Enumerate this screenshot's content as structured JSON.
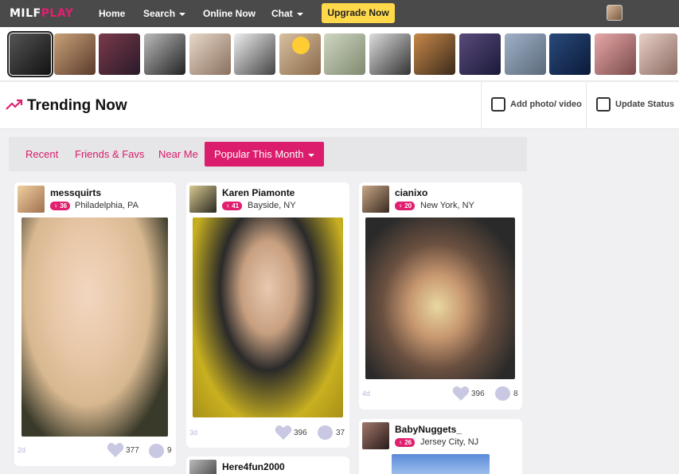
{
  "brand": {
    "logo_part1": "MILF",
    "logo_part2": "PLAY"
  },
  "nav": {
    "home": "Home",
    "search": "Search",
    "online_now": "Online Now",
    "chat": "Chat",
    "upgrade": "Upgrade Now"
  },
  "trending": {
    "title": "Trending Now",
    "add_photo": "Add photo/ video",
    "update_status": "Update Status"
  },
  "tabs": {
    "recent": "Recent",
    "friends": "Friends & Favs",
    "near": "Near Me",
    "popular": "Popular This Month"
  },
  "cards": [
    {
      "username": "messquirts",
      "age": "36",
      "location": "Philadelphia, PA",
      "posted": "2d",
      "likes": "377",
      "comments": "9"
    },
    {
      "username": "Karen Piamonte",
      "age": "41",
      "location": "Bayside, NY",
      "posted": "3d",
      "likes": "396",
      "comments": "37"
    },
    {
      "username": "cianixo",
      "age": "20",
      "location": "New York, NY",
      "posted": "4d",
      "likes": "396",
      "comments": "8"
    },
    {
      "username": "Here4fun2000"
    },
    {
      "username": "BabyNuggets_",
      "age": "26",
      "location": "Jersey City, NJ"
    }
  ],
  "colors": {
    "accent": "#dc1c6c",
    "upgrade": "#ffd94a",
    "nav_bg": "#4a4a4a"
  }
}
